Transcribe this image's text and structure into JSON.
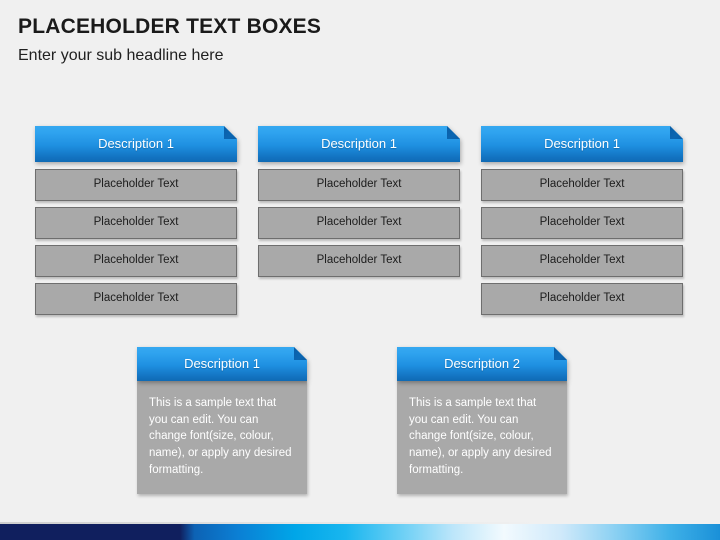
{
  "header": {
    "title": "PLACEHOLDER TEXT BOXES",
    "subtitle": "Enter your sub headline here"
  },
  "colors": {
    "background": "#f0f0f0",
    "banner_blue_light": "#35a8f0",
    "banner_blue_dark": "#0f6ab4",
    "fold_blue": "#0a5fa8",
    "placeholder_gray": "#a9a9a9",
    "placeholder_border": "#6e6e6e",
    "bar_navy": "#101f5e",
    "bar_cyan": "#00a6e8"
  },
  "columns": [
    {
      "banner_label": "Description 1",
      "items": [
        {
          "label": "Placeholder Text"
        },
        {
          "label": "Placeholder Text"
        },
        {
          "label": "Placeholder Text"
        },
        {
          "label": "Placeholder Text"
        }
      ]
    },
    {
      "banner_label": "Description 1",
      "items": [
        {
          "label": "Placeholder Text"
        },
        {
          "label": "Placeholder Text"
        },
        {
          "label": "Placeholder Text"
        }
      ]
    },
    {
      "banner_label": "Description 1",
      "items": [
        {
          "label": "Placeholder Text"
        },
        {
          "label": "Placeholder Text"
        },
        {
          "label": "Placeholder Text"
        },
        {
          "label": "Placeholder Text"
        }
      ]
    }
  ],
  "bottom_cards": [
    {
      "banner_label": "Description 1",
      "body_text": "This is a sample text that you can edit. You can change font(size, colour, name), or apply any desired formatting."
    },
    {
      "banner_label": "Description 2",
      "body_text": "This is a sample text that you can edit. You can change font(size, colour, name), or apply any desired formatting."
    }
  ]
}
